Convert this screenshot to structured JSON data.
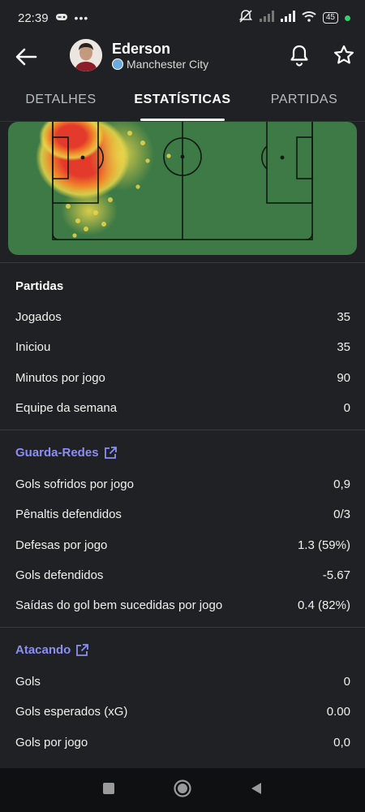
{
  "status_bar": {
    "time": "22:39",
    "battery": "45"
  },
  "header": {
    "player_name": "Ederson",
    "team_name": "Manchester City"
  },
  "tabs": [
    "DETALHES",
    "ESTATÍSTICAS",
    "PARTIDAS"
  ],
  "sections": {
    "partidas": {
      "title": "Partidas",
      "rows": [
        {
          "label": "Jogados",
          "value": "35"
        },
        {
          "label": "Iniciou",
          "value": "35"
        },
        {
          "label": "Minutos por jogo",
          "value": "90"
        },
        {
          "label": "Equipe da semana",
          "value": "0"
        }
      ]
    },
    "goalkeeper": {
      "title": "Guarda-Redes",
      "rows": [
        {
          "label": "Gols sofridos por jogo",
          "value": "0,9"
        },
        {
          "label": "Pênaltis defendidos",
          "value": "0/3"
        },
        {
          "label": "Defesas por jogo",
          "value": "1.3 (59%)"
        },
        {
          "label": "Gols defendidos",
          "value": "-5.67"
        },
        {
          "label": "Saídas do gol bem sucedidas por jogo",
          "value": "0.4 (82%)"
        }
      ]
    },
    "attacking": {
      "title": "Atacando",
      "rows": [
        {
          "label": "Gols",
          "value": "0"
        },
        {
          "label": "Gols esperados (xG)",
          "value": "0.00"
        },
        {
          "label": "Gols por jogo",
          "value": "0,0"
        }
      ]
    }
  },
  "colors": {
    "background": "#1f2124",
    "pitch": "#3d7a45",
    "accent_link": "#8b8ff5",
    "heat_red": "#e43a2c",
    "heat_orange": "#f08a2a",
    "heat_yellow": "#e8d64a"
  }
}
